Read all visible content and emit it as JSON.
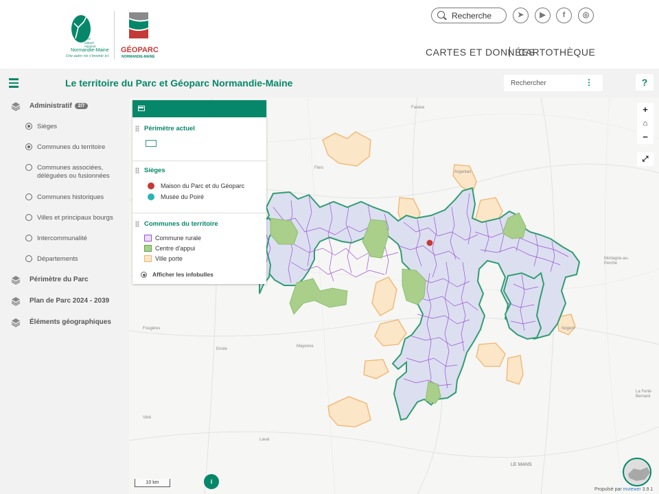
{
  "header": {
    "logo_parc": {
      "line1": "Parc",
      "line2": "naturel",
      "line3": "régional",
      "line4": "Normandie-Maine",
      "tagline": "Une autre vie s'invente ici"
    },
    "logo_geoparc": {
      "name": "GÉOPARC",
      "sub": "NORMANDIE-MAINE"
    },
    "search_placeholder": "Recherche",
    "social": [
      "send-icon",
      "play-icon",
      "facebook-icon",
      "instagram-icon"
    ],
    "nav": [
      "CARTES ET DONNÉES",
      "CARTOTHÈQUE"
    ]
  },
  "titlebar": {
    "title": "Le territoire du Parc et Géoparc Normandie-Maine",
    "search_placeholder": "Rechercher",
    "help": "?"
  },
  "sidebar": {
    "groups": [
      {
        "label": "Administratif",
        "badge": "2/7"
      },
      {
        "label": "Périmètre du Parc"
      },
      {
        "label": "Plan de Parc 2024 - 2039"
      },
      {
        "label": "Éléments géographiques"
      }
    ],
    "items": [
      {
        "label": "Sièges",
        "checked": true
      },
      {
        "label": "Communes du territoire",
        "checked": true
      },
      {
        "label": "Communes associées, déléguées ou fusionnées",
        "checked": false
      },
      {
        "label": "Communes historiques",
        "checked": false
      },
      {
        "label": "Villes et principaux bourgs",
        "checked": false
      },
      {
        "label": "Intercommunalité",
        "checked": false
      },
      {
        "label": "Départements",
        "checked": false
      }
    ]
  },
  "legend": {
    "perimetre": {
      "title": "Périmètre actuel"
    },
    "sieges": {
      "title": "Sièges",
      "items": [
        {
          "label": "Maison du Parc et du Géoparc",
          "color": "#c53a36"
        },
        {
          "label": "Musée du Poiré",
          "color": "#2bb3b7"
        }
      ]
    },
    "communes": {
      "title": "Communes du territoire",
      "items": [
        {
          "label": "Commune rurale",
          "color": "#9b4fd6",
          "fill": "#e9def5"
        },
        {
          "label": "Centre d'appui",
          "color": "#5fa54a",
          "fill": "#a9cf8a"
        },
        {
          "label": "Ville porte",
          "color": "#f0b46d",
          "fill": "#fbe6c8"
        }
      ]
    },
    "infobulles": "Afficher les infobulles"
  },
  "map": {
    "places": [
      "Falaise",
      "Flers",
      "Argentan",
      "Mortagne-au-Perche",
      "Fougères",
      "Ernée",
      "Mayenne",
      "Vitré",
      "Laval",
      "La Ferté-Bernard",
      "LE MANS",
      "Nogent"
    ],
    "scale": "10 km",
    "info": "i",
    "controls": [
      "+",
      "⌂",
      "−",
      "⤢"
    ]
  },
  "credit": {
    "prefix": "Propulsé par",
    "link": "mviewer",
    "version": "3.9.1"
  },
  "colors": {
    "accent": "#07876a",
    "perimeter": "#2e9d71",
    "rural": "#9b4fd6",
    "appui": "#7fb964",
    "porte": "#f0b46d"
  }
}
